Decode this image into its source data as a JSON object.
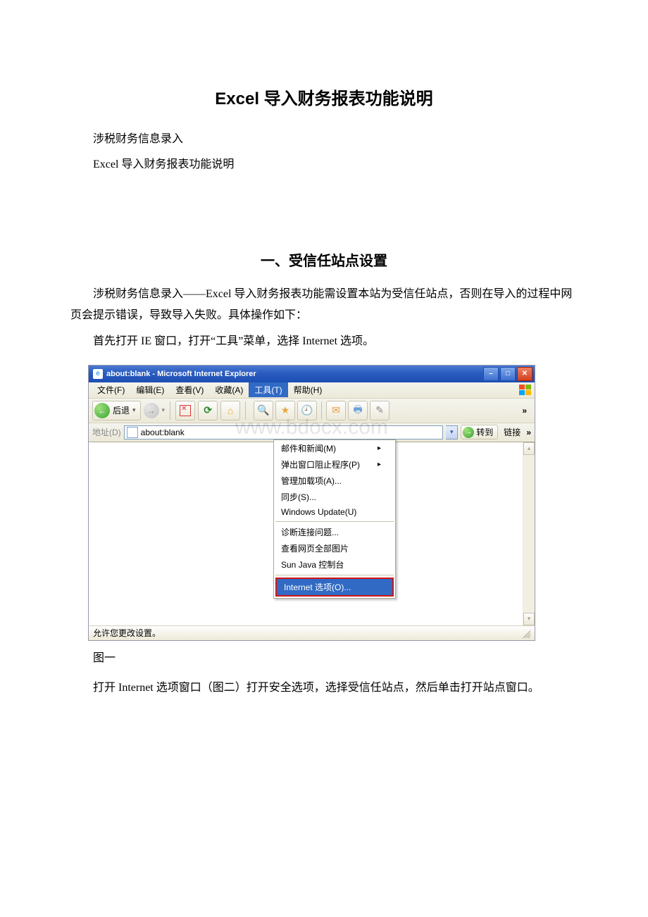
{
  "doc": {
    "title": "Excel 导入财务报表功能说明",
    "intro1": "涉税财务信息录入",
    "intro2": "Excel 导入财务报表功能说明",
    "section1_head": "一、受信任站点设置",
    "section1_p1": "涉税财务信息录入——Excel 导入财务报表功能需设置本站为受信任站点，否则在导入的过程中网页会提示错误，导致导入失败。具体操作如下：",
    "section1_p2": "首先打开 IE 窗口，打开“工具”菜单，选择 Internet 选项。",
    "fig1_caption": "图一",
    "section1_p3": "打开 Internet 选项窗口（图二）打开安全选项，选择受信任站点，然后单击打开站点窗口。"
  },
  "ie": {
    "title": "about:blank - Microsoft Internet Explorer",
    "menu": {
      "file": "文件(F)",
      "edit": "编辑(E)",
      "view": "查看(V)",
      "fav": "收藏(A)",
      "tools": "工具(T)",
      "help": "帮助(H)"
    },
    "toolbar": {
      "back": "后退",
      "go": "转到",
      "links": "链接",
      "overflow": "»"
    },
    "address": {
      "label": "地址(D)",
      "value": "about:blank"
    },
    "tools_menu": {
      "mailnews": "邮件和新闻(M)",
      "popup": "弹出窗口阻止程序(P)",
      "addons": "管理加载项(A)...",
      "sync": "同步(S)...",
      "winupdate": "Windows Update(U)",
      "diagnose": "诊断连接问题...",
      "viewall": "查看网页全部图片",
      "sunjava": "Sun Java 控制台",
      "internetopt": "Internet 选项(O)..."
    },
    "status": "允许您更改设置。",
    "watermark": "www.bdocx.com"
  }
}
